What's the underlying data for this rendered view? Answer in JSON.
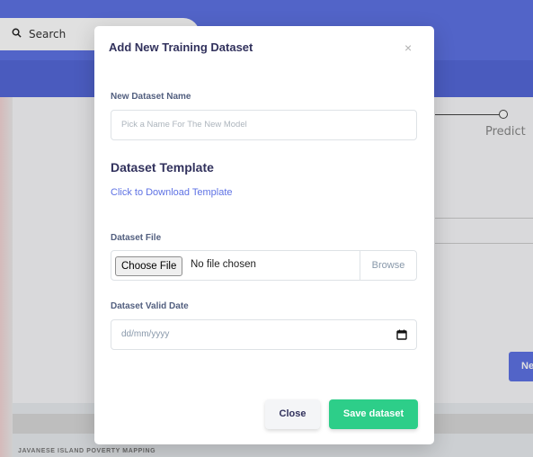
{
  "background": {
    "search_placeholder": "Search",
    "step_label": "Predict",
    "button_partial": "Ne",
    "footer_text": "JAVANESE ISLAND POVERTY MAPPING"
  },
  "modal": {
    "title": "Add New Training Dataset",
    "close_symbol": "×",
    "name_label": "New Dataset Name",
    "name_placeholder": "Pick a Name For The New Model",
    "template_heading": "Dataset Template",
    "template_link": "Click to Download Template",
    "file_label": "Dataset File",
    "choose_file": "Choose File",
    "no_file": "No file chosen",
    "browse": "Browse",
    "date_label": "Dataset Valid Date",
    "date_placeholder": "dd/mm/yyyy",
    "close_button": "Close",
    "save_button": "Save dataset"
  },
  "colors": {
    "primary": "#5e72e4",
    "success": "#2dce89",
    "heading": "#32325d"
  },
  "icons": [
    "search-icon",
    "calendar-icon",
    "close-icon"
  ]
}
